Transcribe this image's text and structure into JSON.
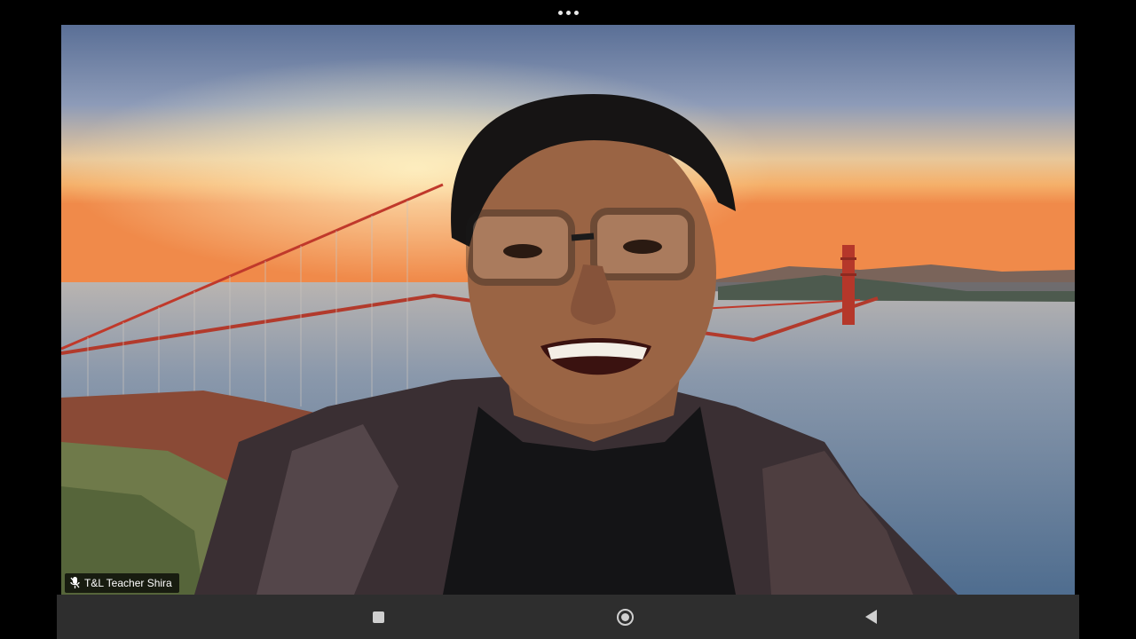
{
  "participant": {
    "name": "T&L Teacher Shira"
  },
  "icons": {
    "more": "more-horizontal-icon",
    "mic": "mic-icon",
    "recents": "square-recents-icon",
    "home": "circle-home-icon",
    "back": "triangle-back-icon"
  },
  "colors": {
    "bridge": "#c0392b",
    "nav_bar": "#2e2e2e",
    "label_bg": "#000000"
  }
}
